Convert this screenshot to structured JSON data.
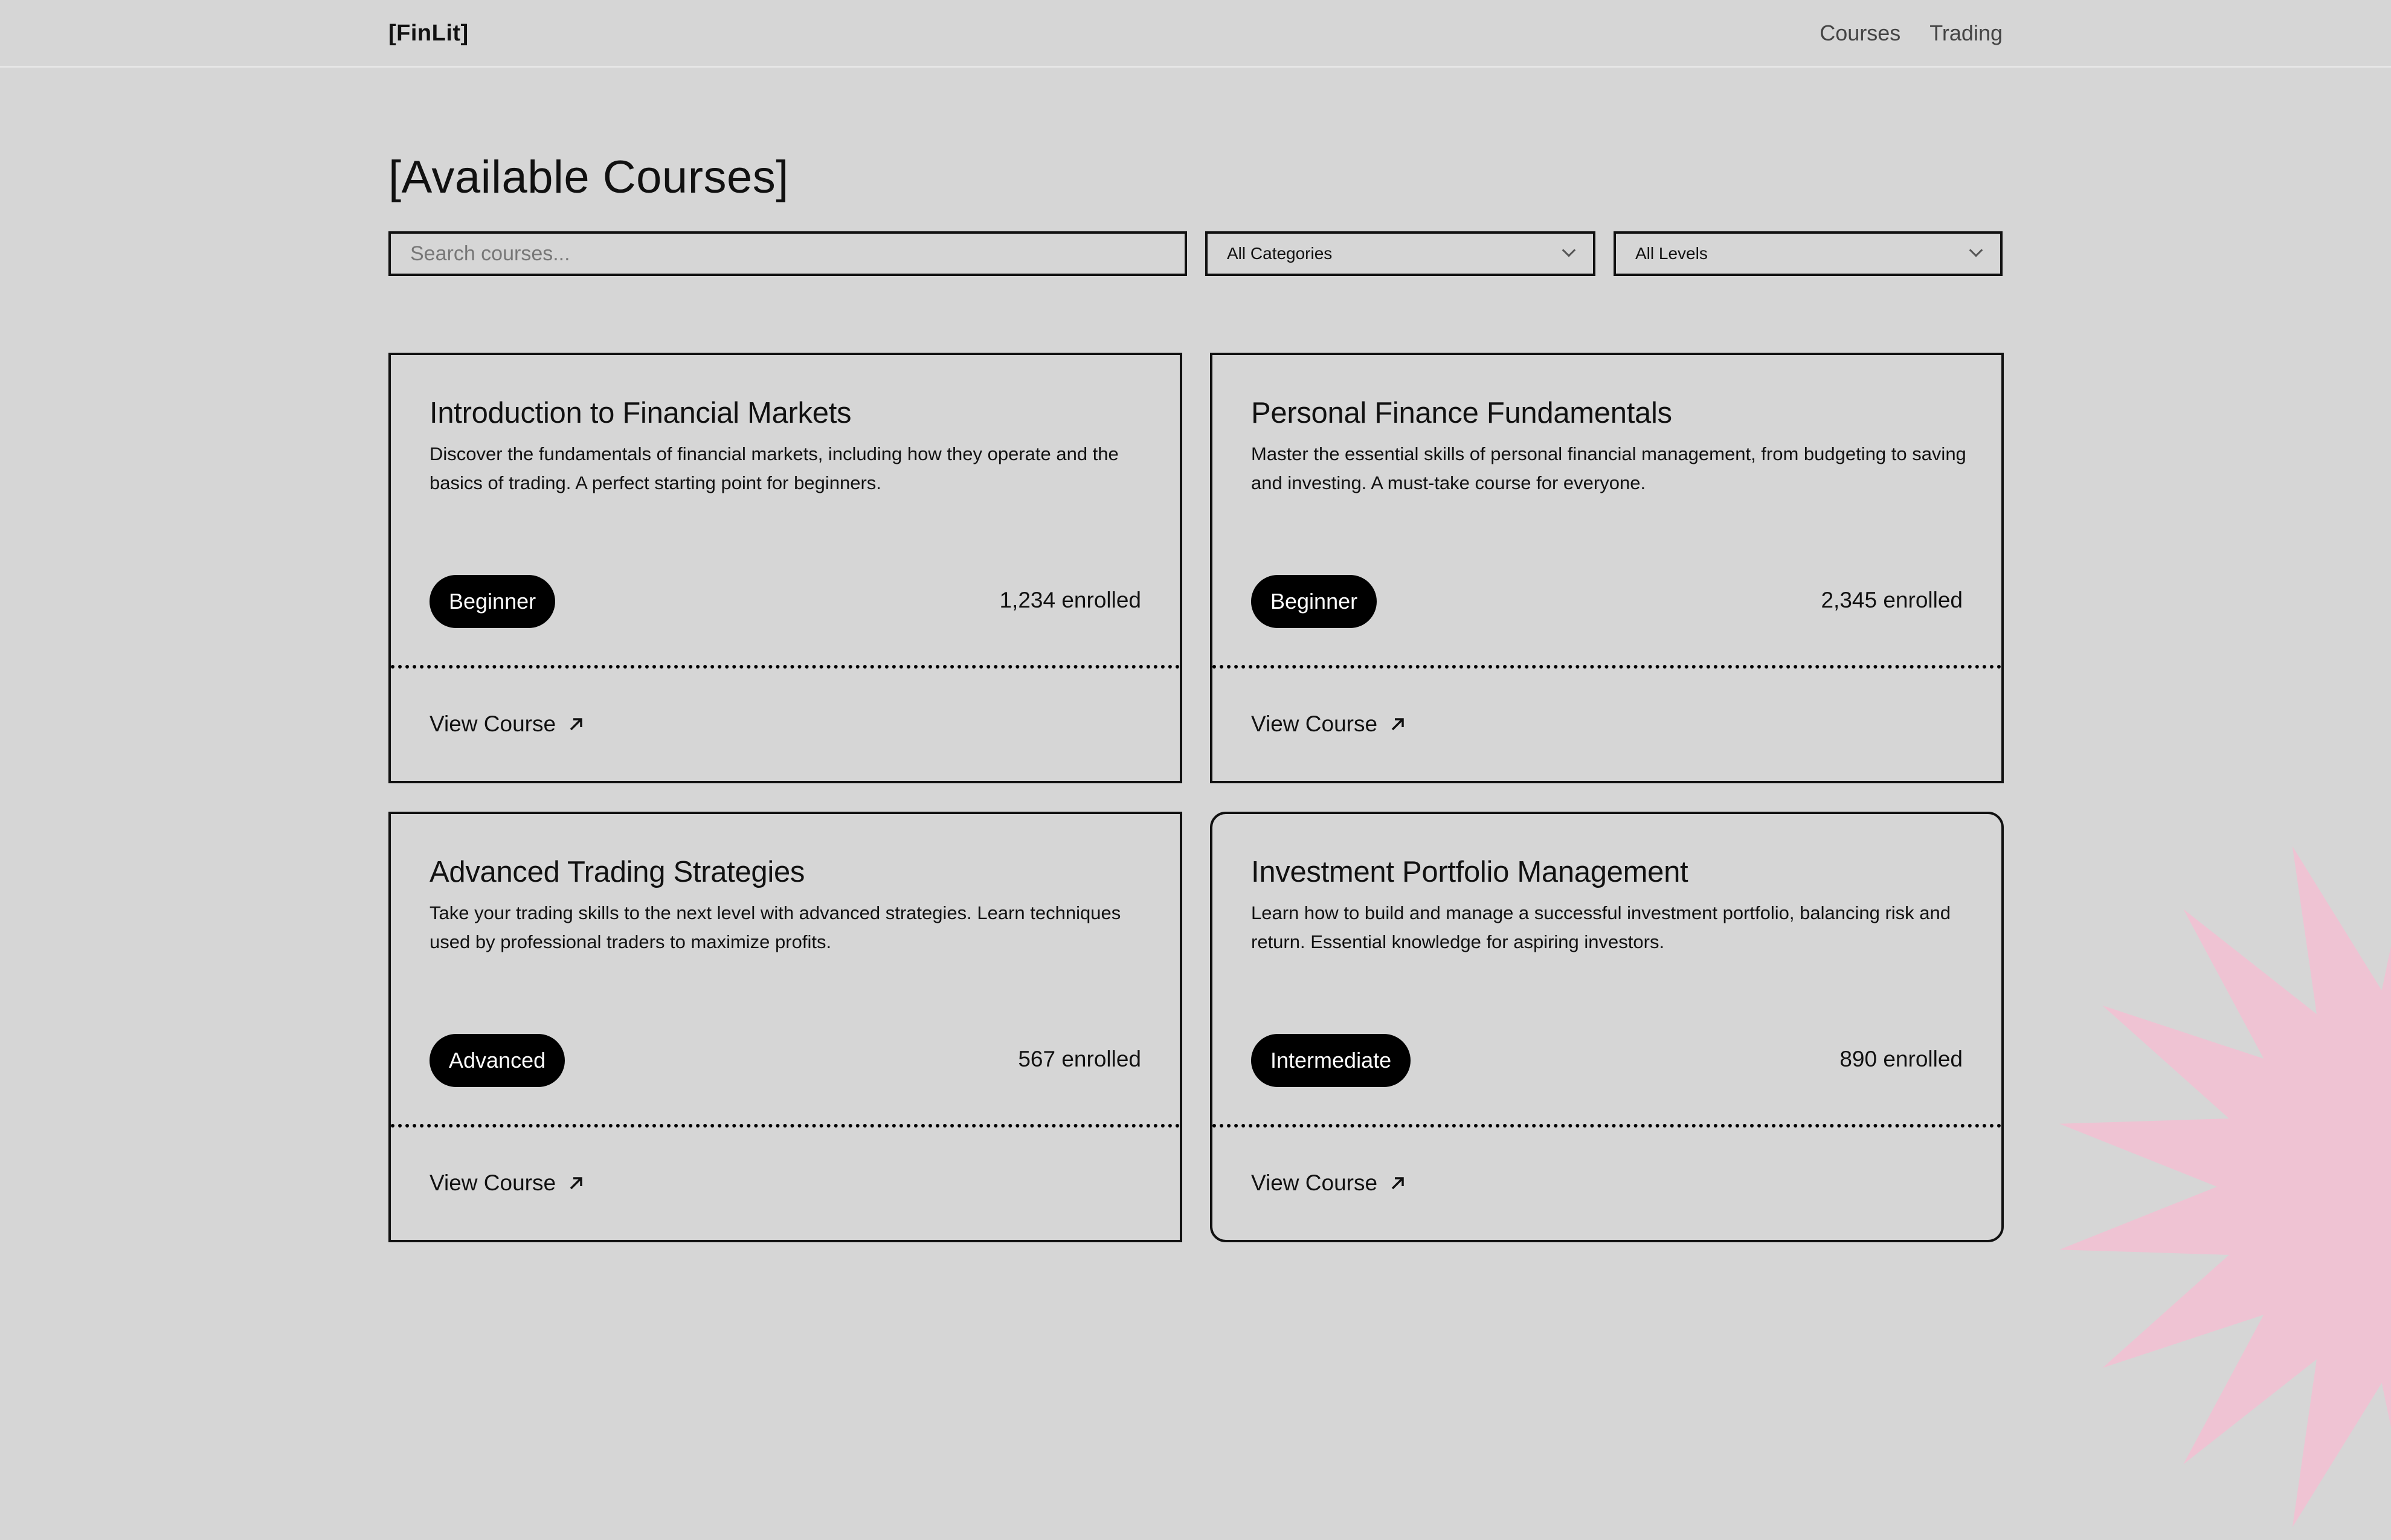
{
  "brand": "[FinLit]",
  "nav": [
    "Courses",
    "Trading"
  ],
  "page_title": "[Available Courses]",
  "filters": {
    "search_placeholder": "Search courses...",
    "category_selected": "All Categories",
    "level_selected": "All Levels"
  },
  "courses": [
    {
      "title": "Introduction to Financial Markets",
      "description": "Discover the fundamentals of financial markets, including how they operate and the basics of trading. A perfect starting point for beginners.",
      "level": "Beginner",
      "enrolled": "1,234 enrolled",
      "cta": "View Course"
    },
    {
      "title": "Personal Finance Fundamentals",
      "description": "Master the essential skills of personal financial management, from budgeting to saving and investing. A must-take course for everyone.",
      "level": "Beginner",
      "enrolled": "2,345 enrolled",
      "cta": "View Course"
    },
    {
      "title": "Advanced Trading Strategies",
      "description": "Take your trading skills to the next level with advanced strategies. Learn techniques used by professional traders to maximize profits.",
      "level": "Advanced",
      "enrolled": "567 enrolled",
      "cta": "View Course"
    },
    {
      "title": "Investment Portfolio Management",
      "description": "Learn how to build and manage a successful investment portfolio, balancing risk and return. Essential knowledge for aspiring investors.",
      "level": "Intermediate",
      "enrolled": "890 enrolled",
      "cta": "View Course"
    }
  ],
  "colors": {
    "background": "#d6d6d6",
    "badge": "#000000",
    "accent_starburst": "#efc3d3"
  },
  "icons": {
    "cta": "arrow-up-right-icon",
    "select": "chevron-down-icon"
  }
}
